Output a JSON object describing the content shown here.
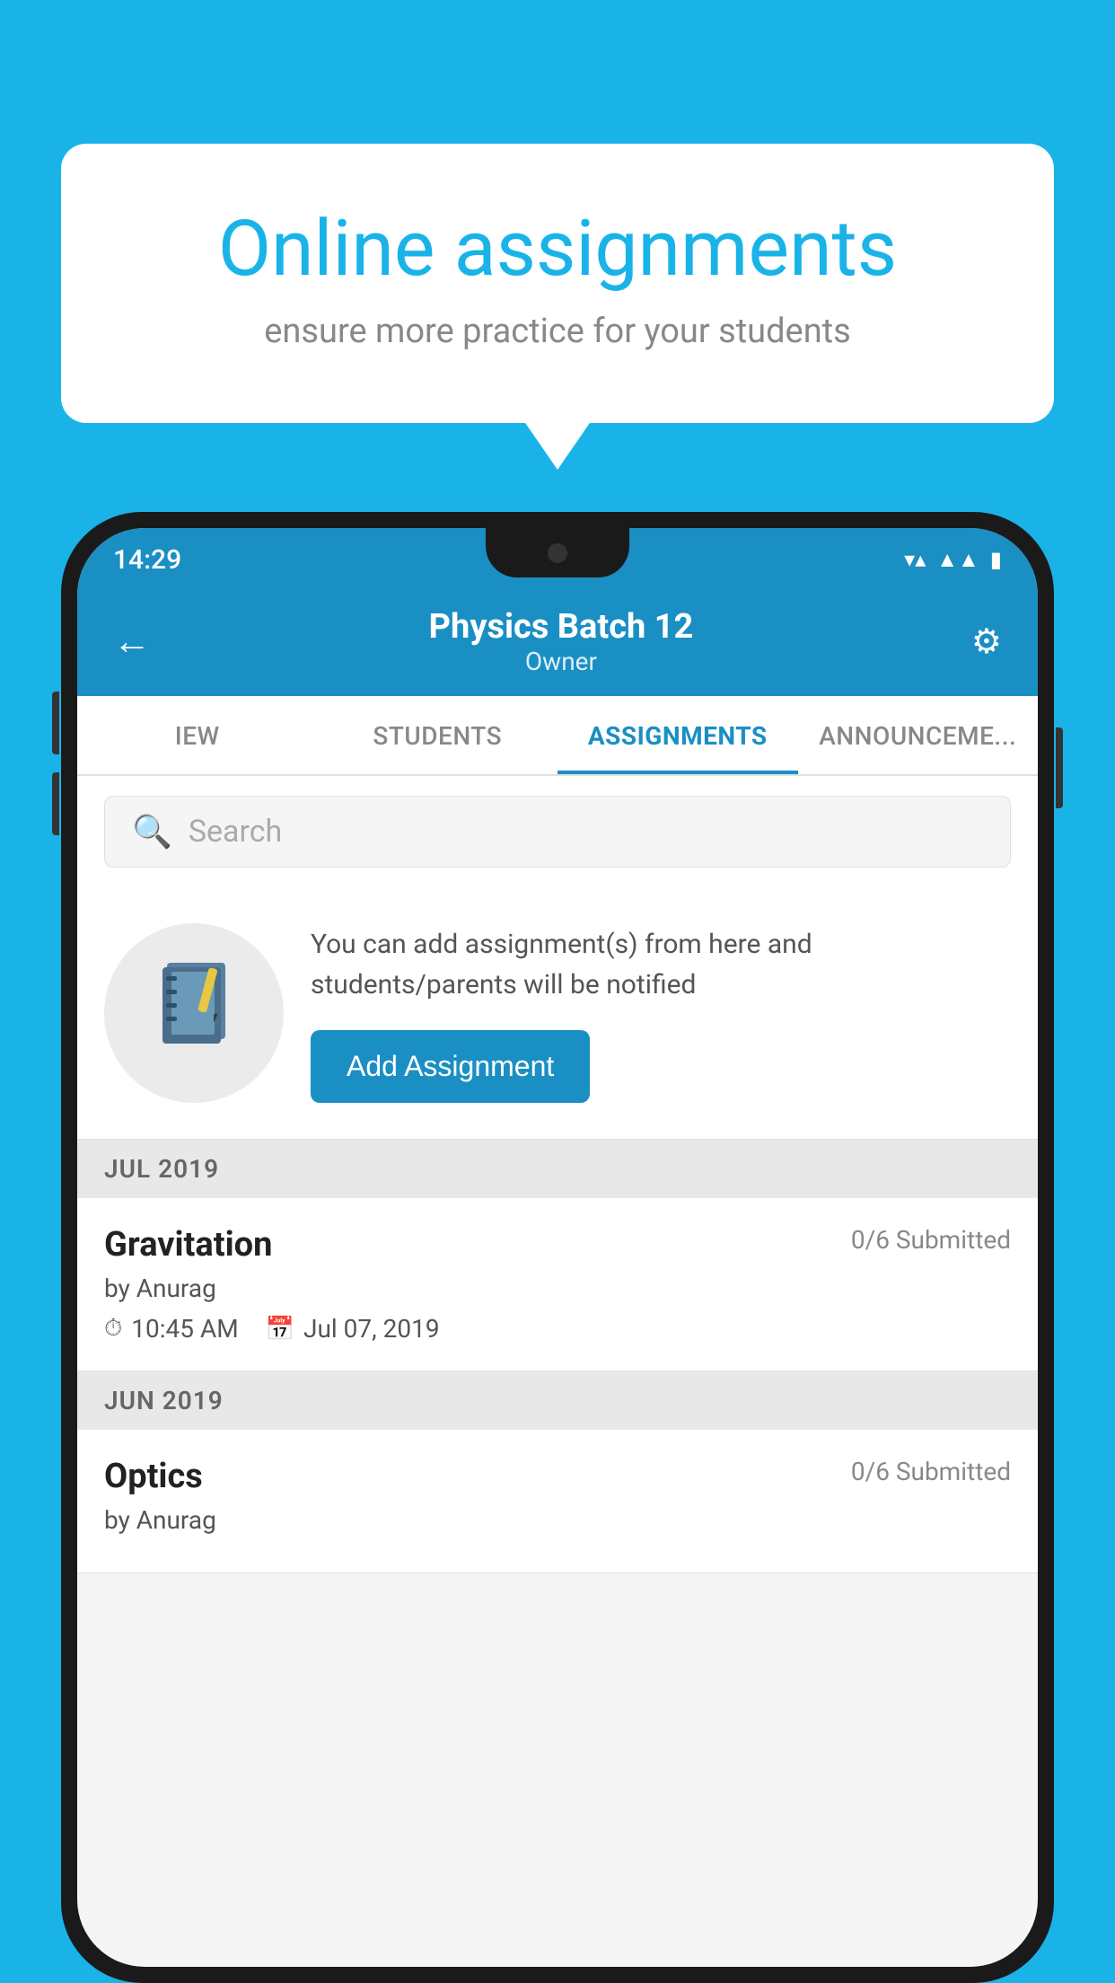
{
  "background_color": "#1ab3e8",
  "bubble": {
    "title": "Online assignments",
    "subtitle": "ensure more practice for your students"
  },
  "phone": {
    "status_bar": {
      "time": "14:29",
      "icons": [
        "wifi",
        "signal",
        "battery"
      ]
    },
    "header": {
      "title": "Physics Batch 12",
      "subtitle": "Owner"
    },
    "tabs": [
      {
        "label": "IEW",
        "active": false
      },
      {
        "label": "STUDENTS",
        "active": false
      },
      {
        "label": "ASSIGNMENTS",
        "active": true
      },
      {
        "label": "ANNOUNCEMENTS",
        "active": false
      }
    ],
    "search": {
      "placeholder": "Search"
    },
    "promo": {
      "text": "You can add assignment(s) from here and students/parents will be notified",
      "button_label": "Add Assignment"
    },
    "assignments": [
      {
        "section": "JUL 2019",
        "name": "Gravitation",
        "submitted": "0/6 Submitted",
        "by": "by Anurag",
        "time": "10:45 AM",
        "date": "Jul 07, 2019"
      },
      {
        "section": "JUN 2019",
        "name": "Optics",
        "submitted": "0/6 Submitted",
        "by": "by Anurag",
        "time": "",
        "date": ""
      }
    ]
  }
}
